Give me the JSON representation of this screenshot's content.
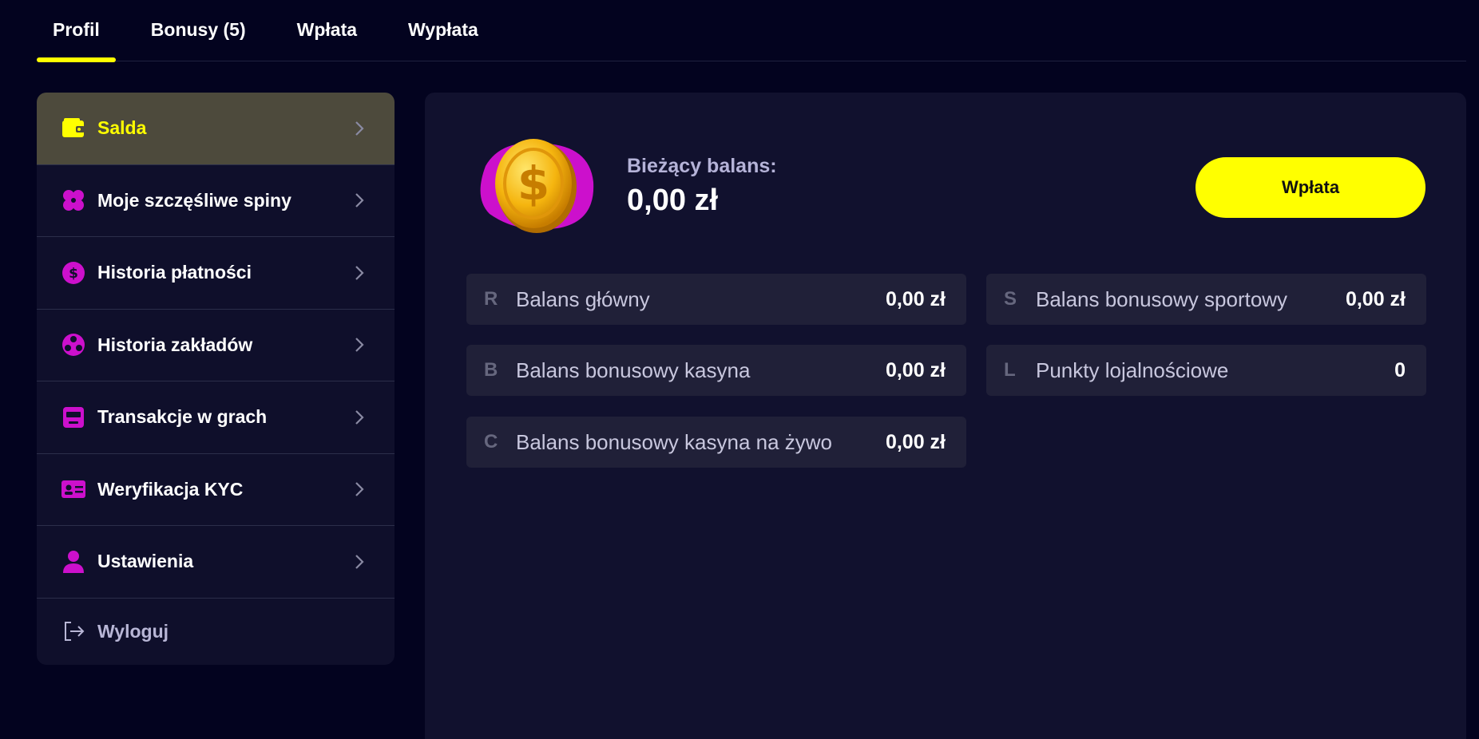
{
  "tabs": [
    {
      "label": "Profil",
      "active": true
    },
    {
      "label": "Bonusy (5)",
      "active": false
    },
    {
      "label": "Wpłata",
      "active": false
    },
    {
      "label": "Wypłata",
      "active": false
    }
  ],
  "sidebar": {
    "items": [
      {
        "label": "Salda",
        "icon": "wallet-icon"
      },
      {
        "label": "Moje szczęśliwe spiny",
        "icon": "clover-icon"
      },
      {
        "label": "Historia płatności",
        "icon": "dollar-icon"
      },
      {
        "label": "Historia zakładów",
        "icon": "ball-icon"
      },
      {
        "label": "Transakcje w grach",
        "icon": "slot-machine-icon"
      },
      {
        "label": "Weryfikacja KYC",
        "icon": "id-card-icon"
      },
      {
        "label": "Ustawienia",
        "icon": "user-icon"
      },
      {
        "label": "Wyloguj",
        "icon": "logout-icon"
      }
    ]
  },
  "main": {
    "balance_label": "Bieżący balans:",
    "balance_value": "0,00 zł",
    "deposit_button": "Wpłata",
    "balances": [
      {
        "letter": "R",
        "name": "Balans główny",
        "value": "0,00 zł"
      },
      {
        "letter": "S",
        "name": "Balans bonusowy sportowy",
        "value": "0,00 zł"
      },
      {
        "letter": "B",
        "name": "Balans bonusowy kasyna",
        "value": "0,00 zł"
      },
      {
        "letter": "L",
        "name": "Punkty lojalnościowe",
        "value": "0"
      },
      {
        "letter": "C",
        "name": "Balans bonusowy kasyna na żywo",
        "value": "0,00 zł"
      }
    ]
  },
  "colors": {
    "accent": "#ffff00",
    "icon": "#cc10cc",
    "background": "#03031f",
    "panel": "#11112e"
  }
}
